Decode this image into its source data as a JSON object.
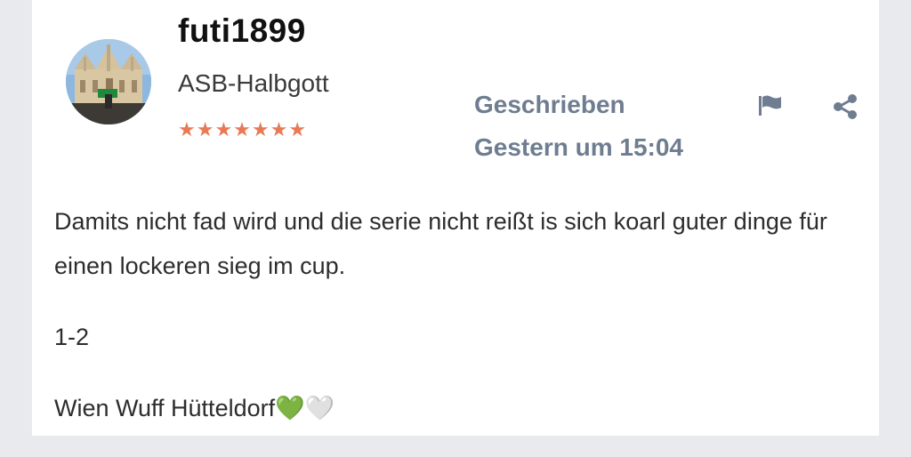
{
  "post": {
    "author": {
      "username": "futi1899",
      "rank": "ASB-Halbgott",
      "stars": "★★★★★★★"
    },
    "meta": {
      "label": "Geschrieben",
      "date": "Gestern um 15:04"
    },
    "actions": {
      "flag_icon": "flag-icon",
      "share_icon": "share-icon"
    },
    "content": {
      "paragraph_1": "Damits nicht fad wird und die serie nicht reißt is sich koarl guter dinge für einen lockeren sieg im cup.",
      "paragraph_2": "1-2",
      "paragraph_3": "Wien Wuff Hütteldorf💚🤍"
    }
  },
  "colors": {
    "meta_text": "#6f7d91",
    "stars": "#e87a55",
    "page_background": "#e9eaed"
  }
}
